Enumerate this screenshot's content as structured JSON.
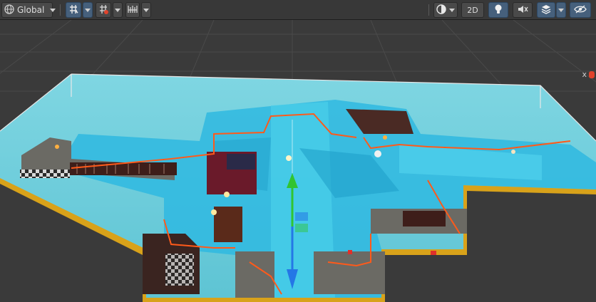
{
  "toolbar": {
    "pivot_label": "Global",
    "mode_2d_label": "2D",
    "icons": [
      "globe-icon",
      "grid-snap-icon",
      "grid-toggle-icon",
      "increment-snap-icon",
      "shading-mode-icon",
      "lighting-icon",
      "audio-mute-icon",
      "effects-icon",
      "hidden-objects-icon"
    ]
  },
  "scene": {
    "axis_label": "x",
    "colors": {
      "background": "#3a3a3a",
      "floor": "#6fd1de",
      "navmesh": "#2fb9e0",
      "walls": "#6b6a64",
      "outline": "#ff5a1a",
      "yaxis": "#31c431",
      "zaxis": "#2477e6",
      "base": "#d8a21a"
    }
  }
}
